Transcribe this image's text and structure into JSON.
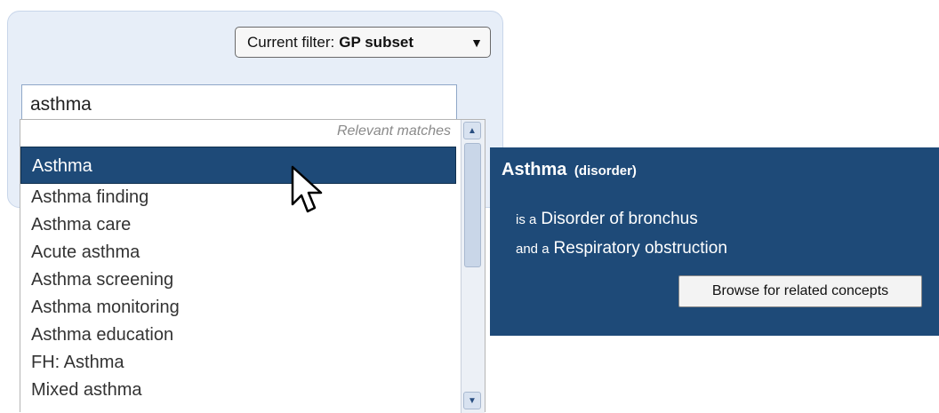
{
  "filter": {
    "label": "Current filter:",
    "value": "GP subset",
    "arrow": "▼"
  },
  "search": {
    "value": "asthma"
  },
  "results": {
    "hint": "Relevant matches",
    "selected_index": 0,
    "items": [
      "Asthma",
      "Asthma finding",
      "Asthma care",
      "Acute asthma",
      "Asthma screening",
      "Asthma monitoring",
      "Asthma education",
      "FH: Asthma",
      "Mixed asthma"
    ]
  },
  "scrollbar": {
    "up_icon": "▲",
    "down_icon": "▼"
  },
  "details": {
    "title": "Asthma",
    "semantic_tag": "(disorder)",
    "relationships": [
      {
        "prefix": "is a",
        "target": "Disorder of bronchus"
      },
      {
        "prefix": "and a",
        "target": "Respiratory obstruction"
      }
    ],
    "browse_label": "Browse for related concepts"
  },
  "colors": {
    "accent": "#1e4a78",
    "panel_bg": "#e7eef8"
  }
}
